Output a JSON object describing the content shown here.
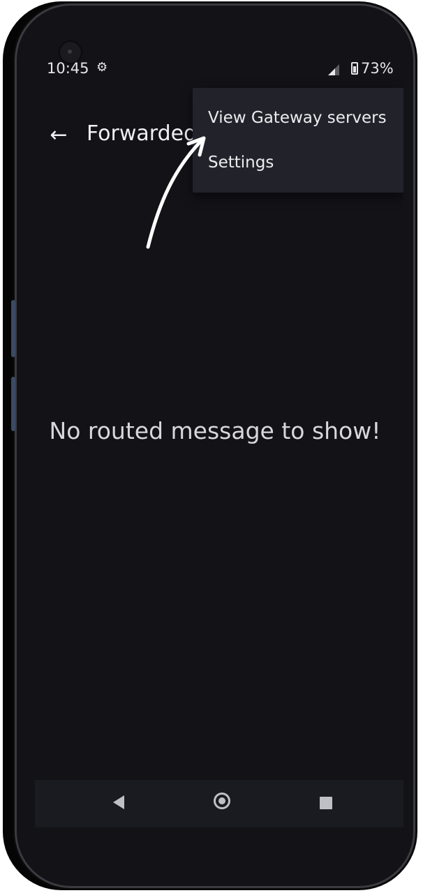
{
  "status_bar": {
    "time": "10:45",
    "settings_icon": "gear-icon",
    "signal_icon": "signal-icon",
    "battery_icon": "battery-icon",
    "battery_level": "73%"
  },
  "app_bar": {
    "back_icon": "arrow-back-icon",
    "title": "Forwarded"
  },
  "overflow_menu": {
    "items": [
      {
        "label": "View Gateway servers"
      },
      {
        "label": "Settings"
      }
    ]
  },
  "main": {
    "empty_message": "No routed message to show!"
  },
  "nav_bar": {
    "back_icon": "nav-back-icon",
    "home_icon": "nav-home-icon",
    "recents_icon": "nav-recents-icon"
  },
  "colors": {
    "background": "#121217",
    "menu_background": "#22232a",
    "text_primary": "#f0f0f2",
    "nav_bar": "#1a1b20"
  }
}
